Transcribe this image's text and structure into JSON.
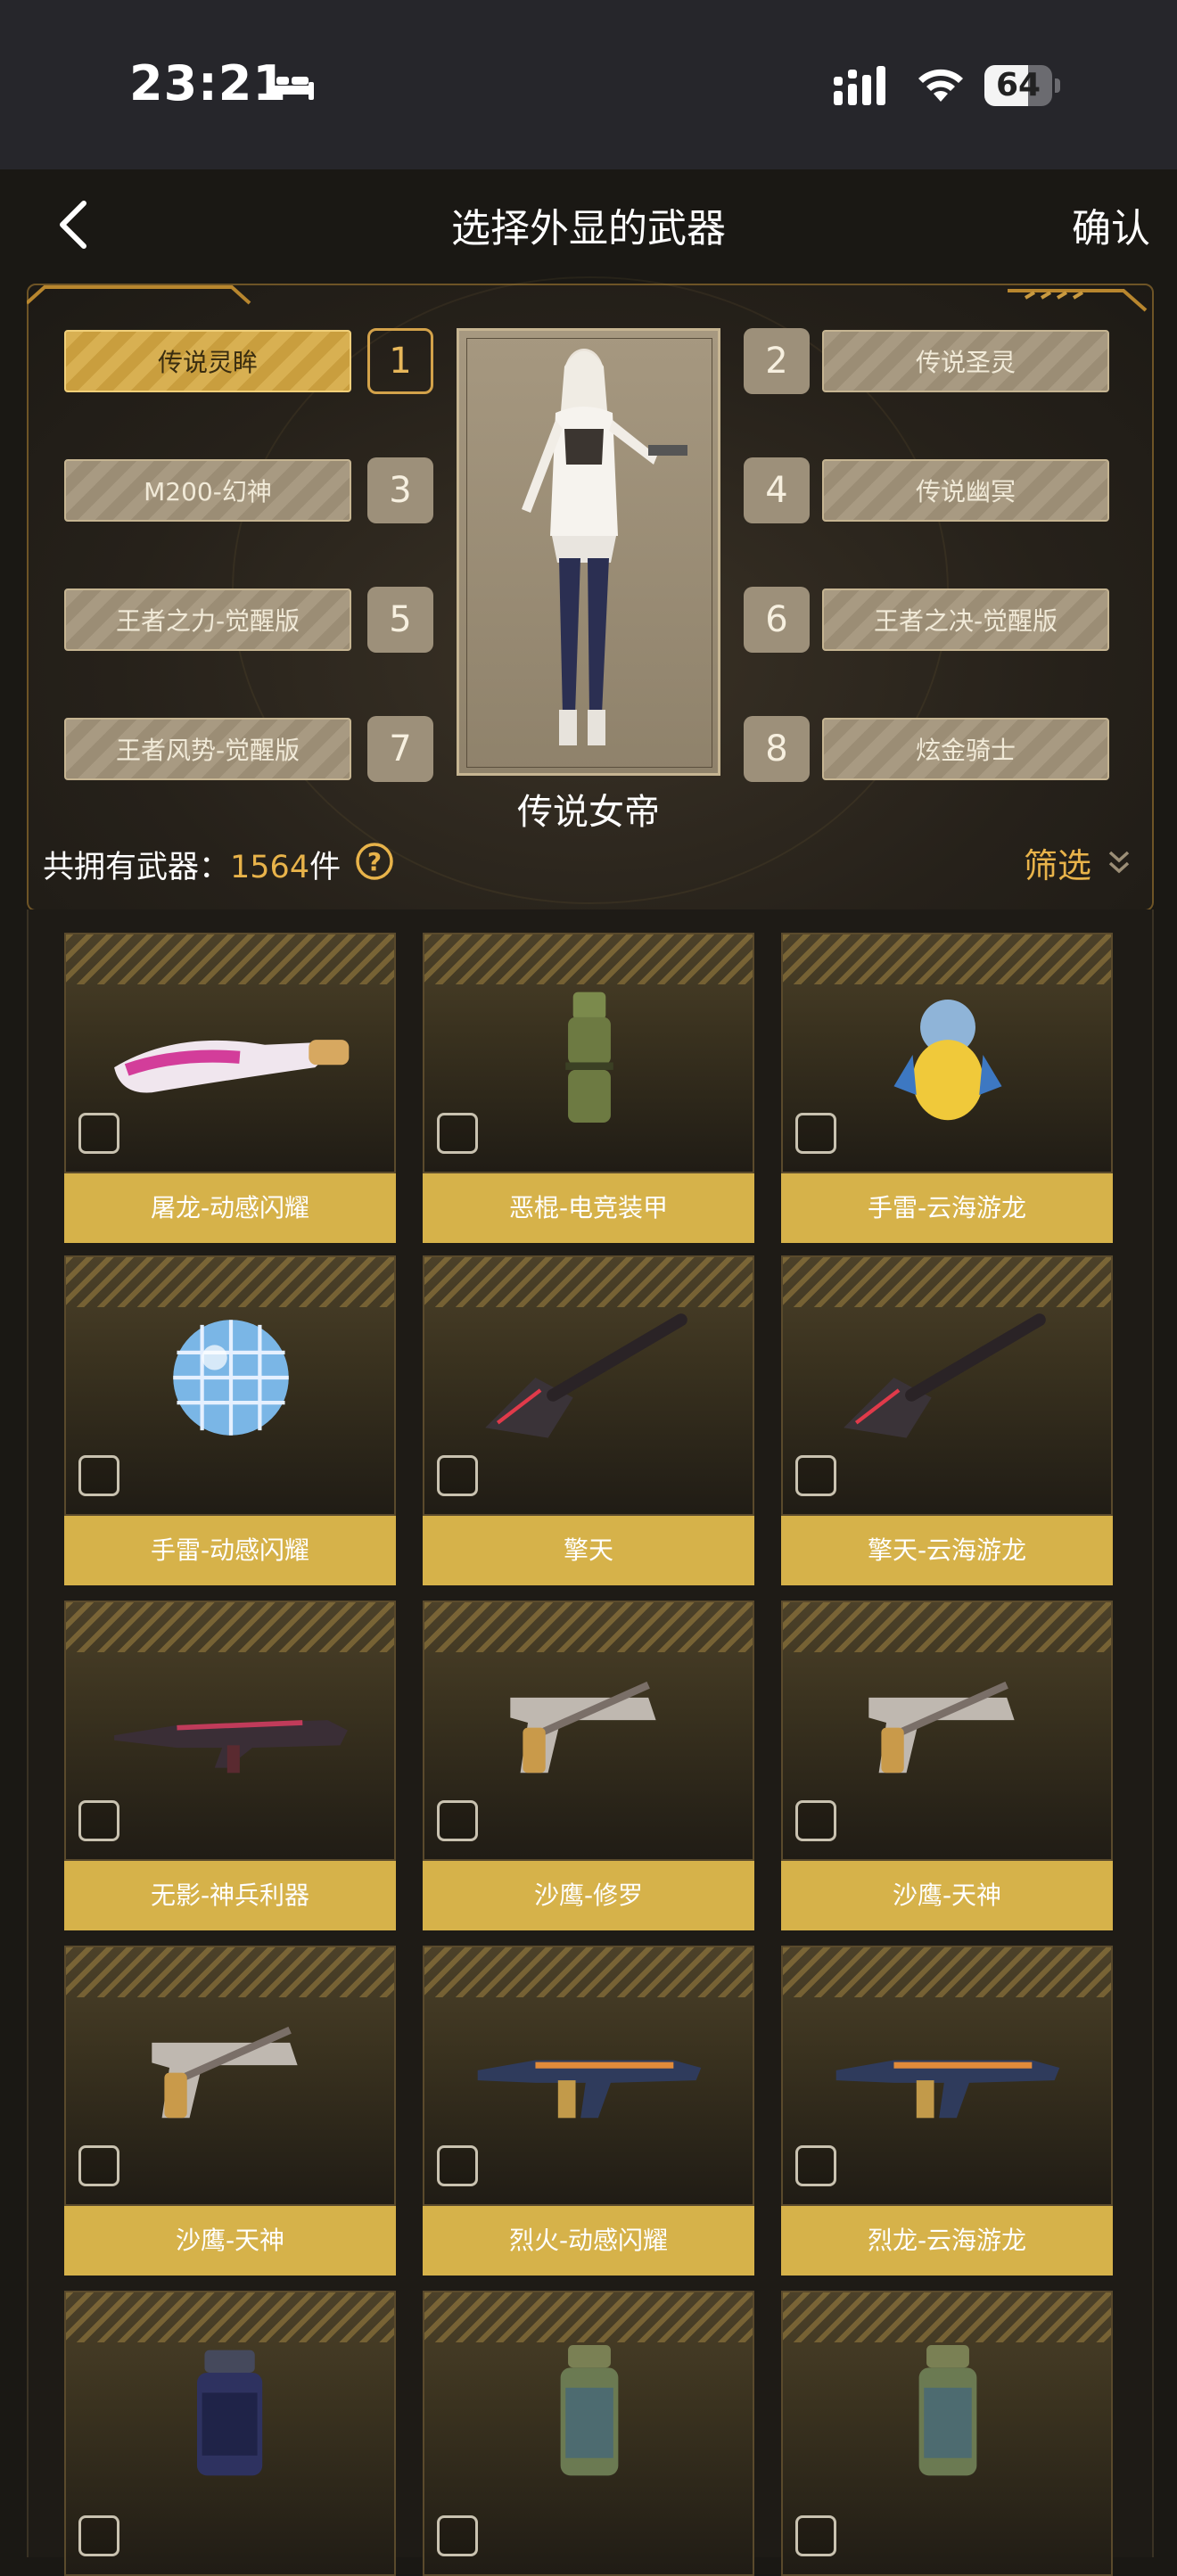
{
  "status": {
    "time": "23:21",
    "battery": "64",
    "battery_level": 0.64
  },
  "header": {
    "title": "选择外显的武器",
    "confirm": "确认"
  },
  "slots": [
    {
      "num": "1",
      "label": "传说灵眸",
      "active": true
    },
    {
      "num": "2",
      "label": "传说圣灵",
      "active": false
    },
    {
      "num": "3",
      "label": "M200-幻神",
      "active": false
    },
    {
      "num": "4",
      "label": "传说幽冥",
      "active": false
    },
    {
      "num": "5",
      "label": "王者之力-觉醒版",
      "active": false
    },
    {
      "num": "6",
      "label": "王者之决-觉醒版",
      "active": false
    },
    {
      "num": "7",
      "label": "王者风势-觉醒版",
      "active": false
    },
    {
      "num": "8",
      "label": "炫金骑士",
      "active": false
    }
  ],
  "character": {
    "name": "传说女帝"
  },
  "summary": {
    "label": "共拥有武器：",
    "count": "1564",
    "unit": "件",
    "filter": "筛选"
  },
  "weapons": [
    {
      "name": "屠龙-动感闪耀",
      "icon": "knife-icon"
    },
    {
      "name": "恶棍-电竞装甲",
      "icon": "grenade-icon"
    },
    {
      "name": "手雷-云海游龙",
      "icon": "grenade-figure-icon"
    },
    {
      "name": "手雷-动感闪耀",
      "icon": "disco-ball-icon"
    },
    {
      "name": "擎天",
      "icon": "shovel-icon"
    },
    {
      "name": "擎天-云海游龙",
      "icon": "shovel-icon"
    },
    {
      "name": "无影-神兵利器",
      "icon": "rifle-icon"
    },
    {
      "name": "沙鹰-修罗",
      "icon": "pistol-icon"
    },
    {
      "name": "沙鹰-天神",
      "icon": "pistol-icon"
    },
    {
      "name": "沙鹰-天神",
      "icon": "pistol-icon"
    },
    {
      "name": "烈火-动感闪耀",
      "icon": "smg-icon"
    },
    {
      "name": "烈龙-云海游龙",
      "icon": "smg-icon"
    },
    {
      "name": "",
      "icon": "canister-icon"
    },
    {
      "name": "",
      "icon": "smoke-grenade-icon"
    },
    {
      "name": "",
      "icon": "smoke-grenade-icon"
    }
  ]
}
